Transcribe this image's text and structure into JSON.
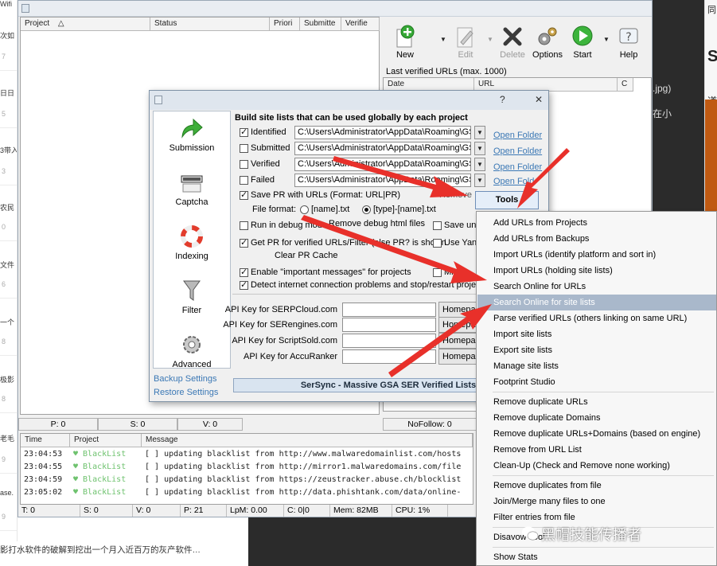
{
  "left_strip": {
    "fragments": [
      "Wifi",
      "次如",
      "7",
      "日日",
      "5",
      "3带入",
      "3",
      "农民",
      "0",
      "文件",
      "6",
      "一个",
      "8",
      "极影",
      "8",
      "老毛",
      "9",
      "ase.",
      "9"
    ],
    "bottom_caption": "影打水软件的破解到挖出一个月入近百万的灰产软件…"
  },
  "right_strip": {
    "frag_top": "同",
    "frag_s": "S",
    "frag_dao": "道",
    "bg_jpg": ".jpg)",
    "bg_zaixiao": "在小"
  },
  "main_window": {
    "project_table": {
      "headers": [
        "Project",
        "Status",
        "Priori",
        "Submitte",
        "Verifie"
      ],
      "sort_indicator": "△"
    },
    "toolbar": [
      {
        "label": "New",
        "icon": "new-plus-icon",
        "enabled": true
      },
      {
        "label": "Edit",
        "icon": "edit-pencil-icon",
        "enabled": false
      },
      {
        "label": "Delete",
        "icon": "delete-x-icon",
        "enabled": false
      },
      {
        "label": "Options",
        "icon": "options-gears-icon",
        "enabled": true
      },
      {
        "label": "Start",
        "icon": "start-play-icon",
        "enabled": true
      },
      {
        "label": "Help",
        "icon": "help-icon",
        "enabled": true
      }
    ],
    "last_verified_label": "Last verified URLs (max. 1000)",
    "url_table_headers": [
      "Date",
      "URL",
      "C"
    ],
    "status_bar_top": {
      "p": "P: 0",
      "s": "S: 0",
      "v": "V: 0",
      "nofollow": "NoFollow: 0"
    },
    "log": {
      "headers": [
        "Time",
        "Project",
        "Message"
      ],
      "rows": [
        {
          "time": "23:04:53",
          "project": "♥ BlackList",
          "message": "[ ] updating blacklist from http://www.malwaredomainlist.com/hosts"
        },
        {
          "time": "23:04:55",
          "project": "♥ BlackList",
          "message": "[ ] updating blacklist from http://mirror1.malwaredomains.com/file"
        },
        {
          "time": "23:04:59",
          "project": "♥ BlackList",
          "message": "[ ] updating blacklist from https://zeustracker.abuse.ch/blocklist"
        },
        {
          "time": "23:05:02",
          "project": "♥ BlackList",
          "message": "[ ] updating blacklist from http://data.phishtank.com/data/online-"
        }
      ]
    },
    "status_bar_bottom": {
      "t": "T: 0",
      "s": "S: 0",
      "v": "V: 0",
      "p": "P: 21",
      "lpm": "LpM: 0.00",
      "c": "C: 0|0",
      "mem": "Mem: 82MB",
      "cpu": "CPU: 1%"
    }
  },
  "options_dialog": {
    "title_controls": {
      "help": "?",
      "close": "✕"
    },
    "nav": [
      {
        "label": "Submission",
        "icon": "submission-arrow-icon"
      },
      {
        "label": "Captcha",
        "icon": "captcha-icon"
      },
      {
        "label": "Indexing",
        "icon": "indexing-lifebuoy-icon"
      },
      {
        "label": "Filter",
        "icon": "filter-funnel-icon"
      },
      {
        "label": "Advanced",
        "icon": "advanced-gear-icon"
      }
    ],
    "backup_settings": "Backup Settings",
    "restore_settings": "Restore Settings",
    "heading": "Build site lists that can be used globally by each project",
    "site_lists": [
      {
        "label": "Identified",
        "checked": true,
        "path": "C:\\Users\\Administrator\\AppData\\Roaming\\GS",
        "open_folder": "Open Folder"
      },
      {
        "label": "Submitted",
        "checked": false,
        "path": "C:\\Users\\Administrator\\AppData\\Roaming\\GS",
        "open_folder": "Open Folder"
      },
      {
        "label": "Verified",
        "checked": false,
        "path": "C:\\Users\\Administrator\\AppData\\Roaming\\GS",
        "open_folder": "Open Folder"
      },
      {
        "label": "Failed",
        "checked": false,
        "path": "C:\\Users\\Administrator\\AppData\\Roaming\\GS",
        "open_folder": "Open Fold"
      }
    ],
    "save_pr": {
      "label": "Save PR with URLs (Format: URL|PR)",
      "checked": true,
      "remove": "Remove"
    },
    "file_format": {
      "label": "File format:",
      "opt1": "[name].txt",
      "opt2": "[type]-[name].txt",
      "selected": 2
    },
    "debug_mode": {
      "label": "Run in debug mode",
      "checked": false,
      "remove_html": "Remove debug html files"
    },
    "save_unk": {
      "label": "Save unk",
      "checked": false
    },
    "get_pr": {
      "label": "Get PR for verified URLs/Filter  (else PR? is shown",
      "checked": true
    },
    "use_yan": {
      "label": "Use Yand",
      "checked": false
    },
    "clear_pr": "Clear PR Cache",
    "important_msgs": {
      "label": "Enable \"important messages\" for projects",
      "checked": true
    },
    "minim": {
      "label": "Minim",
      "checked": false
    },
    "detect_internet": {
      "label": "Detect internet connection problems and stop/restart projec",
      "checked": true
    },
    "api_keys": [
      {
        "label": "API Key for SERPCloud.com",
        "button": "Homepa"
      },
      {
        "label": "API Key for SERengines.com",
        "button": "Homepa"
      },
      {
        "label": "API Key for ScriptSold.com",
        "button": "Homepa"
      },
      {
        "label": "API Key for AccuRanker",
        "button": "Homepa"
      }
    ],
    "sersync_button": "SerSync - Massive GSA SER Verified Lists",
    "tools_button": "Tools"
  },
  "context_menu": {
    "items": [
      {
        "label": "Add URLs from Projects",
        "highlighted": false
      },
      {
        "label": "Add URLs from Backups",
        "highlighted": false
      },
      {
        "label": "Import URLs (identify platform and sort in)",
        "highlighted": false
      },
      {
        "label": "Import URLs (holding site lists)",
        "highlighted": false
      },
      {
        "label": "Search Online for URLs",
        "highlighted": false
      },
      {
        "label": "Search Online for site lists",
        "highlighted": true
      },
      {
        "label": "Parse verified URLs (others linking on same URL)",
        "highlighted": false
      },
      {
        "label": "Import site lists",
        "highlighted": false
      },
      {
        "label": "Export site lists",
        "highlighted": false
      },
      {
        "label": "Manage site lists",
        "highlighted": false
      },
      {
        "label": "Footprint Studio",
        "highlighted": false
      },
      {
        "label": "Remove duplicate URLs",
        "highlighted": false
      },
      {
        "label": "Remove duplicate Domains",
        "highlighted": false
      },
      {
        "label": "Remove duplicate URLs+Domains (based on engine)",
        "highlighted": false
      },
      {
        "label": "Remove from URL List",
        "highlighted": false
      },
      {
        "label": "Clean-Up (Check and Remove none working)",
        "highlighted": false
      },
      {
        "label": "Remove duplicates from file",
        "highlighted": false
      },
      {
        "label": "Join/Merge many files to one",
        "highlighted": false
      },
      {
        "label": "Filter entries from file",
        "highlighted": false
      },
      {
        "label": "Disavow Tool",
        "highlighted": false
      },
      {
        "label": "Show Stats",
        "highlighted": false
      }
    ]
  },
  "watermark": "黑帽技能传播者",
  "colors": {
    "arrow": "#e8302a",
    "menu_highlight": "#a9b8cb",
    "link": "#3b78b5",
    "log_project": "#6ec26e"
  }
}
